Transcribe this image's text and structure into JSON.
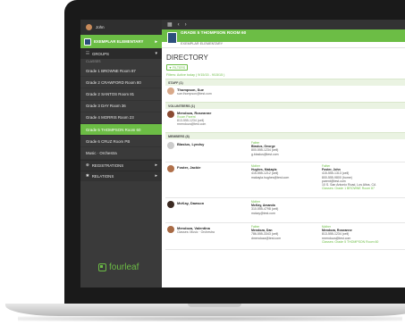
{
  "sidebar": {
    "user_name": "John",
    "school": "EXEMPLAR ELEMENTARY",
    "groups_label": "GROUPS",
    "classes_label": "CLASSES",
    "classes": [
      "Grade 1 BROWNE Room 87",
      "Grade 2 CRAWFORD Room 80",
      "Grade 2 SANTOS Room 81",
      "Grade 3 DAY Room 36",
      "Grade 4 MORRIS Room 23",
      "Grade 5 THOMPSON Room 60",
      "Grade 6 CRUZ Room PB",
      "Music · Orchestra"
    ],
    "active_class_index": 5,
    "registrations_label": "REGISTRATIONS",
    "relations_label": "RELATIONS",
    "logo_text": "fourleaf"
  },
  "main": {
    "header_title": "GRADE 5 THOMPSON ROOM 60",
    "header_sub": "EXEMPLAR ELEMENTARY",
    "directory_title": "DIRECTORY",
    "filters_button": "▼ FILTERS",
    "filters_line": "Filters: Active today ( 9/15/15 - 9/15/15 )",
    "staff": {
      "heading": "STAFF (1)",
      "name": "Thompson, Sue",
      "email": "sue.thompson@test.com"
    },
    "volunteers": {
      "heading": "VOLUNTEERS (1)",
      "name": "Mendoza, Roseanne",
      "role": "Room Parent",
      "phone": "813-555-1234 (cell)",
      "email": "rmendoza@test.com"
    },
    "members": {
      "heading": "MEMBERS (8)",
      "rows": [
        {
          "name": "Blaslus, Lyndsy",
          "note": "",
          "p1": {
            "role": "Father",
            "name": "Blaslus, George",
            "lines": [
              "800-555-1234 (cell)",
              "g.blaslus@test.com"
            ]
          },
          "p2": null
        },
        {
          "name": "Foster, Jackie",
          "note": "",
          "p1": {
            "role": "Mother",
            "name": "Hughes, Makayla",
            "lines": [
              "415-555-1212 (cell)",
              "makayla.hughes@test.com"
            ]
          },
          "p2": {
            "role": "Father",
            "name": "Foster, John",
            "lines": [
              "415-555-1313 (cell)",
              "800-555-9800 (home)",
              "parent@test.com",
              "10 S. San Antonio Road, Los Altos, CA"
            ],
            "classes": "Classes: Grade 1 BROWNE Room 87"
          }
        },
        {
          "name": "McKay, Dawson",
          "note": "",
          "p1": {
            "role": "Mother",
            "name": "McKay, Amanda",
            "lines": [
              "310-555-4798 (cell)",
              "mckay@test.com"
            ]
          },
          "p2": null
        },
        {
          "name": "Mendoza, Valentina",
          "note": "Classes: Music · Orchestra",
          "p1": {
            "role": "Father",
            "name": "Mendoza, Dan",
            "lines": [
              "786-555-3343 (cell)",
              "dmendoza@test.com"
            ]
          },
          "p2": {
            "role": "Mother",
            "name": "Mendoza, Roseanne",
            "lines": [
              "813-555-1234 (cell)",
              "rmendoza@test.com"
            ],
            "classes": "Classes: Grade 5 THOMPSON Room 60"
          }
        }
      ]
    }
  },
  "colors": {
    "accent": "#6cbd45",
    "sidebar": "#3a3a3a",
    "crest": "#2c4f7c"
  }
}
